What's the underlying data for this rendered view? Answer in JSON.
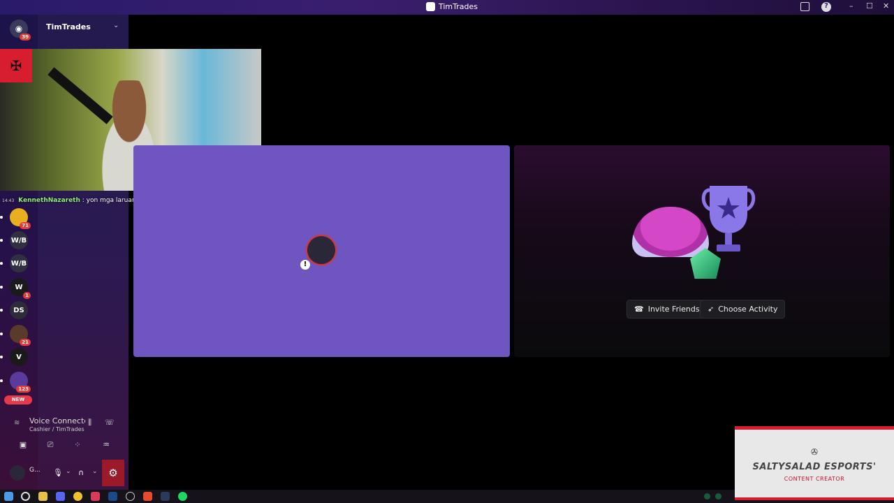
{
  "window": {
    "title": "TimTrades",
    "minimize": "–",
    "maximize": "☐",
    "close": "✕"
  },
  "server_list": {
    "home_badge": "39",
    "servers": [
      {
        "label": "",
        "badge": "71",
        "color": "#e8b020"
      },
      {
        "label": "W/B",
        "badge": "",
        "color": "#303040"
      },
      {
        "label": "W/B",
        "badge": "",
        "color": "#303040"
      },
      {
        "label": "W",
        "badge": "1",
        "color": "#1a1a1a"
      },
      {
        "label": "DS",
        "badge": "",
        "color": "#2c2c3a"
      },
      {
        "label": "",
        "badge": "21",
        "color": "#5a3a2a"
      },
      {
        "label": "V",
        "badge": "",
        "color": "#1a1a1a"
      },
      {
        "label": "",
        "badge": "123",
        "color": "#5a3a9a"
      }
    ],
    "new_label": "NEW"
  },
  "channel": {
    "server_name": "TimTrades",
    "chevron": "⌄"
  },
  "chat_overlay": {
    "time": "14:43",
    "username": "KennethNazareth",
    "message": ": yon mga laruan mo dale pang bading"
  },
  "activity": {
    "invite_label": "Invite Friends",
    "activity_label": "Choose Activity"
  },
  "voice": {
    "status": "Voice Connected",
    "location": "Cashier / TimTrades"
  },
  "user": {
    "name": "G..."
  },
  "overlay_banner": {
    "icon": "✇",
    "title": "SALTYSALAD ESPORTS'",
    "subtitle": "CONTENT CREATOR"
  },
  "colors": {
    "accent": "#6e55bf",
    "danger": "#d81e2e"
  }
}
